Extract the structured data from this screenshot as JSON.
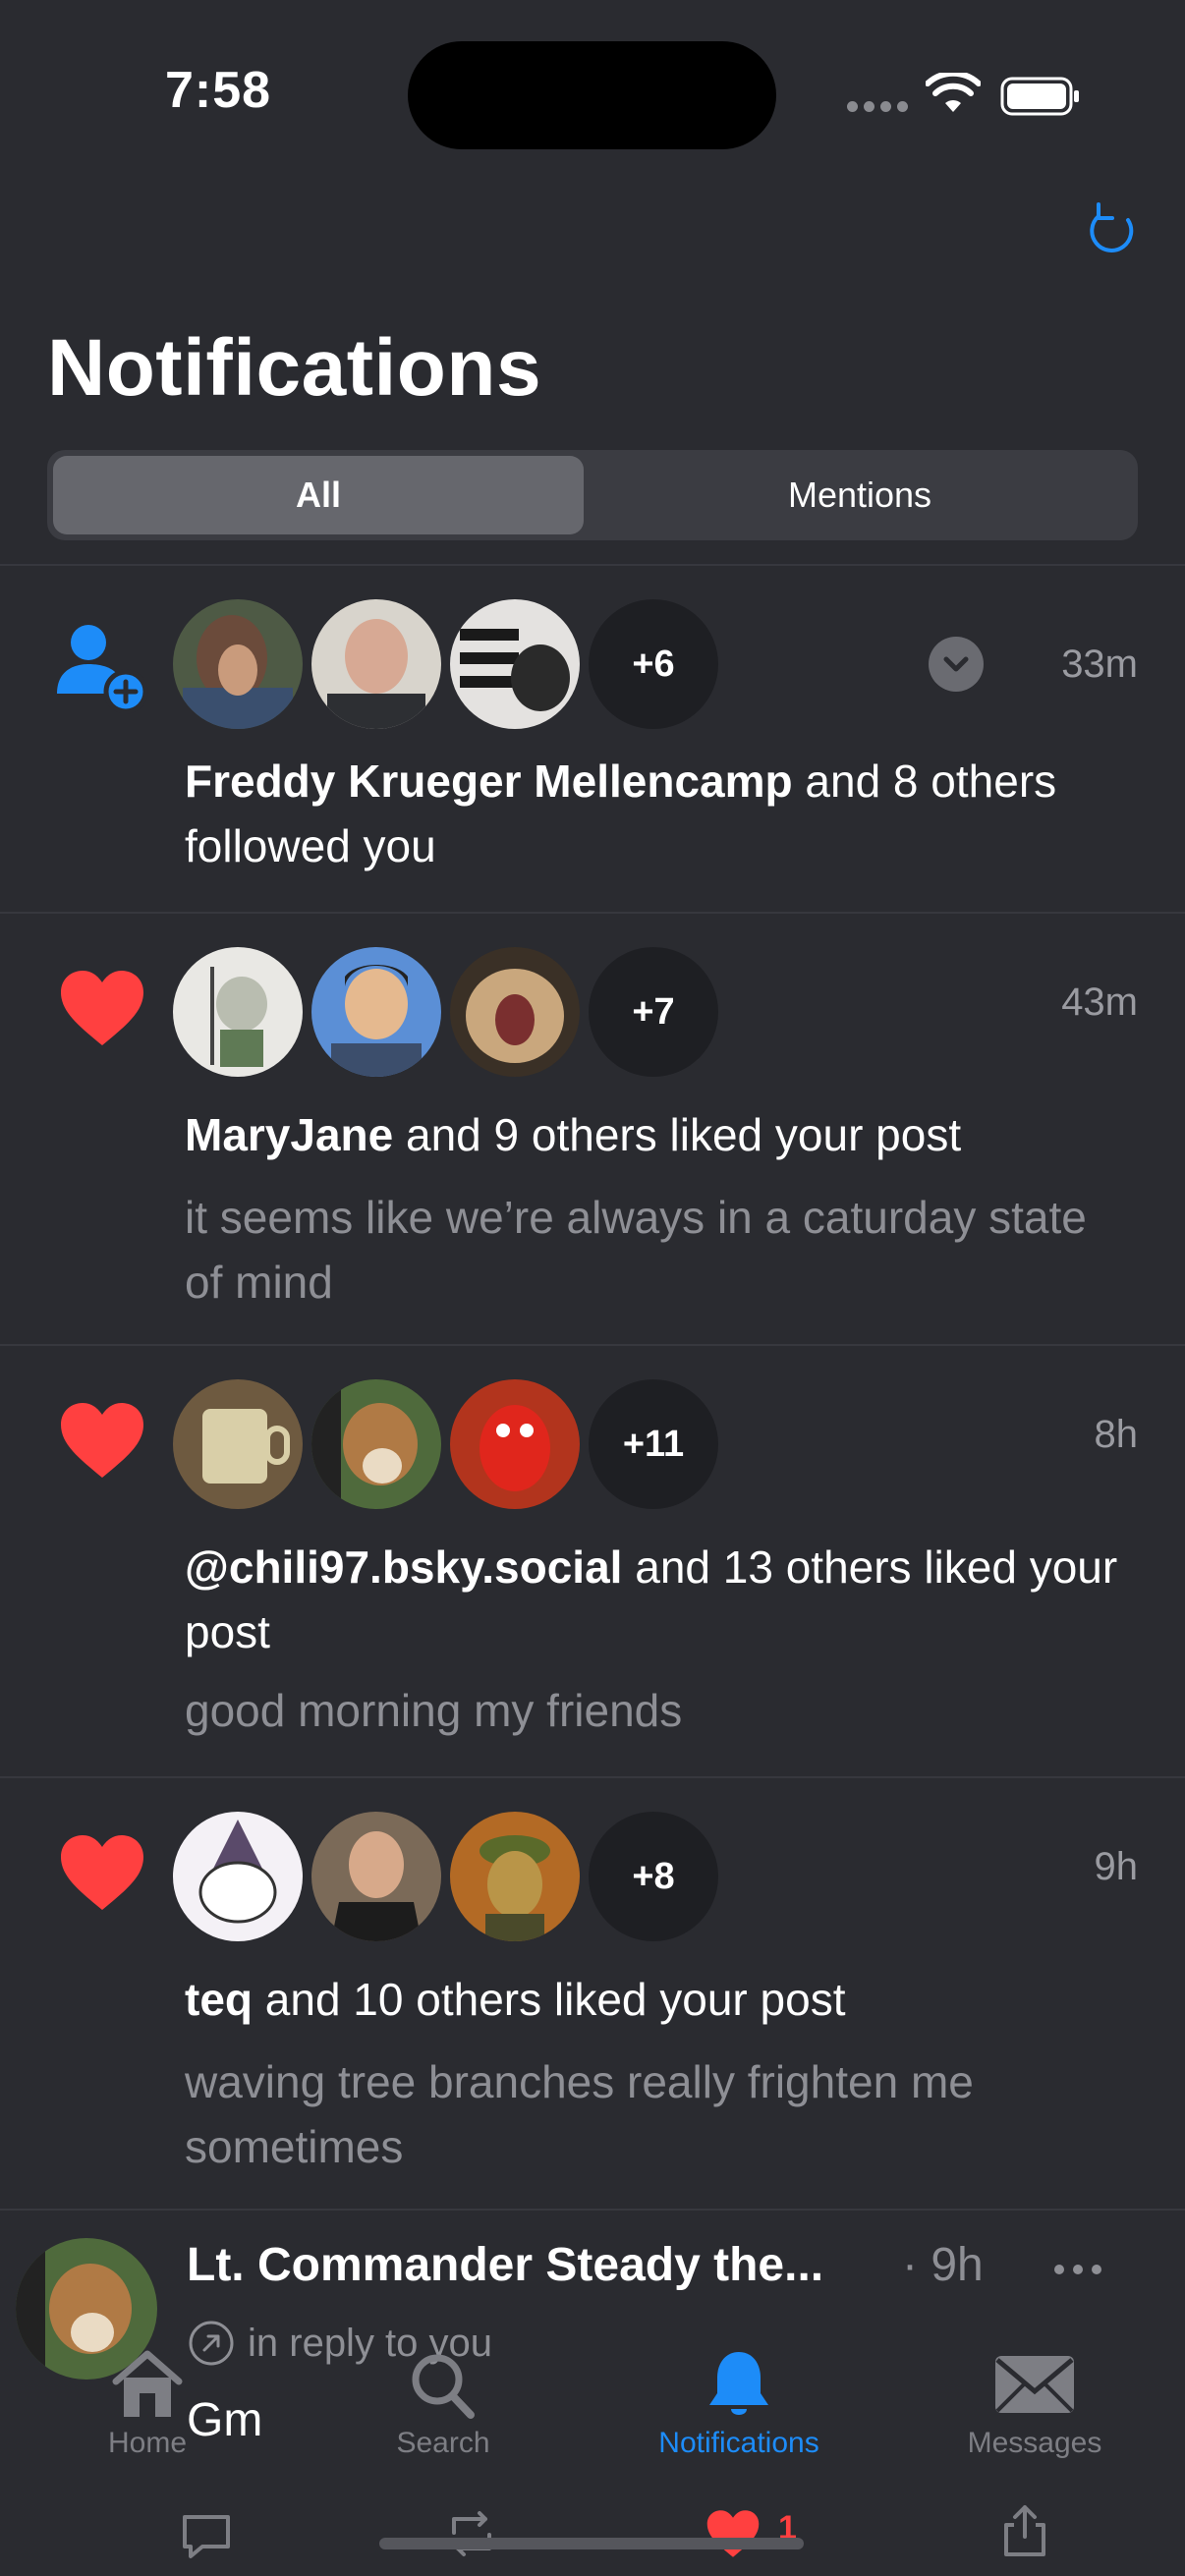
{
  "status_bar": {
    "time": "7:58"
  },
  "header": {
    "title": "Notifications"
  },
  "tabs": {
    "all": "All",
    "mentions": "Mentions"
  },
  "notifications": [
    {
      "type": "follow",
      "more": "+6",
      "age": "33m",
      "actor": "Freddy Krueger Mellencamp",
      "rest": " and 8 others followed you",
      "snippet": ""
    },
    {
      "type": "like",
      "more": "+7",
      "age": "43m",
      "actor": "MaryJane",
      "rest": " and 9 others liked your post",
      "snippet": "it seems like we’re always in a caturday state of mind"
    },
    {
      "type": "like",
      "more": "+11",
      "age": "8h",
      "actor": "@chili97.bsky.social",
      "rest": " and 13 others liked your post",
      "snippet": "good morning my friends"
    },
    {
      "type": "like",
      "more": "+8",
      "age": "9h",
      "actor": "teq",
      "rest": " and 10 others liked your post",
      "snippet": "waving tree branches really frighten me sometimes"
    }
  ],
  "post": {
    "author": "Lt. Commander Steady the...",
    "separator": "·",
    "age": "9h",
    "reply_label": "in reply to you",
    "text": "Gm",
    "likes": "1"
  },
  "tabbar": {
    "home": "Home",
    "search": "Search",
    "notifications": "Notifications",
    "messages": "Messages"
  },
  "colors": {
    "background": "#2a2b30",
    "accent": "#1d8cf8",
    "like": "#ff4d4d"
  }
}
